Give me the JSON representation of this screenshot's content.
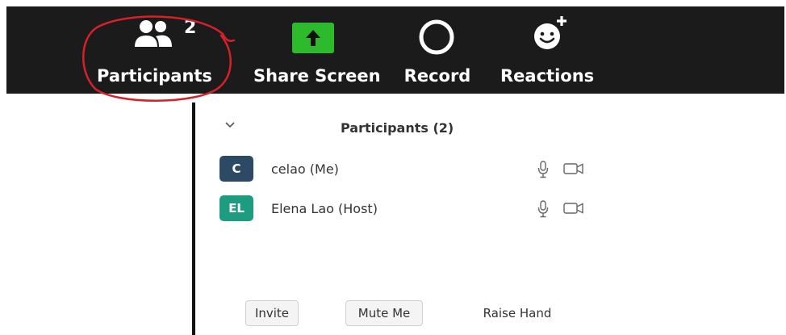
{
  "toolbar": {
    "participants": {
      "label": "Participants",
      "count": "2",
      "icon": "participants-icon"
    },
    "share_screen": {
      "label": "Share Screen",
      "icon": "share-screen-arrow-icon",
      "color": "#2dbb2d"
    },
    "record": {
      "label": "Record",
      "icon": "record-circle-icon"
    },
    "reactions": {
      "label": "Reactions",
      "icon": "smiley-plus-icon"
    }
  },
  "panel": {
    "title": "Participants (2)",
    "collapse_icon": "chevron-down-icon",
    "participants": [
      {
        "initials": "C",
        "name": "celao (Me)",
        "avatar_color": "#2c4a66"
      },
      {
        "initials": "EL",
        "name": "Elena Lao (Host)",
        "avatar_color": "#1e9c82"
      }
    ],
    "buttons": {
      "invite": "Invite",
      "mute_me": "Mute Me",
      "raise_hand": "Raise Hand"
    }
  },
  "annotations": {
    "circle_color": "#d8202a",
    "highlight_color": "#f3f31a"
  }
}
